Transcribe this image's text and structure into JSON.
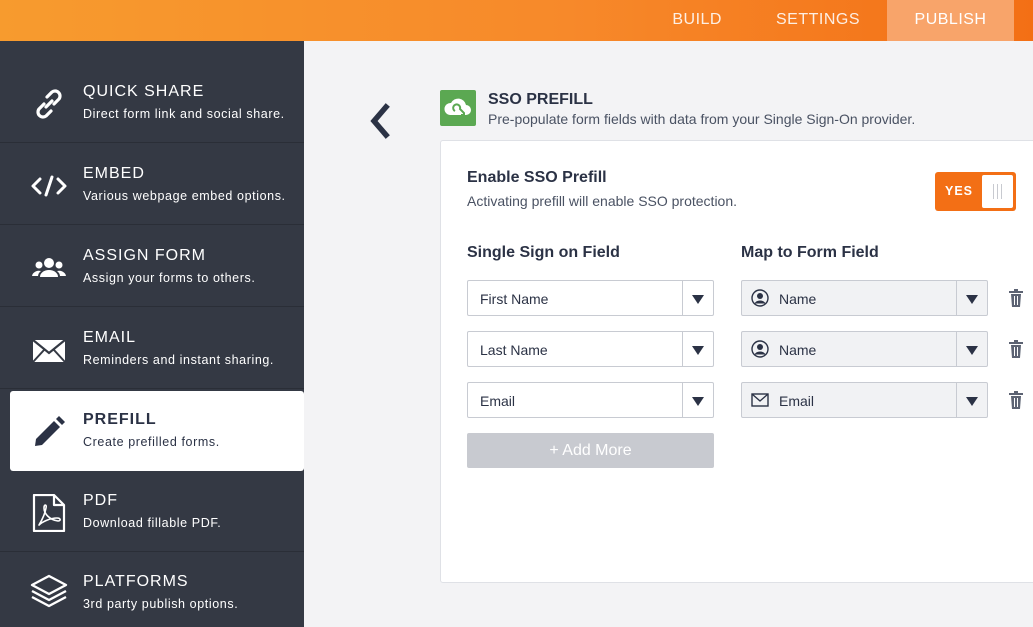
{
  "topnav": {
    "tabs": [
      {
        "label": "BUILD"
      },
      {
        "label": "SETTINGS"
      },
      {
        "label": "PUBLISH",
        "active": true
      }
    ]
  },
  "sidebar": {
    "items": [
      {
        "title": "QUICK SHARE",
        "subtitle": "Direct form link and social share.",
        "icon": "link-icon"
      },
      {
        "title": "EMBED",
        "subtitle": "Various webpage embed options.",
        "icon": "code-icon"
      },
      {
        "title": "ASSIGN FORM",
        "subtitle": "Assign your forms to others.",
        "icon": "users-icon"
      },
      {
        "title": "EMAIL",
        "subtitle": "Reminders and instant sharing.",
        "icon": "envelope-icon"
      },
      {
        "title": "PREFILL",
        "subtitle": "Create prefilled forms.",
        "icon": "pencil-icon",
        "active": true
      },
      {
        "title": "PDF",
        "subtitle": "Download fillable PDF.",
        "icon": "pdf-icon"
      },
      {
        "title": "PLATFORMS",
        "subtitle": "3rd party publish options.",
        "icon": "layers-icon"
      }
    ]
  },
  "header": {
    "title": "SSO PREFILL",
    "subtitle": "Pre-populate form fields with data from your Single Sign-On provider."
  },
  "panel": {
    "enable_title": "Enable SSO Prefill",
    "enable_subtitle": "Activating prefill will enable SSO protection.",
    "toggle_label": "YES",
    "col_sso": "Single Sign on Field",
    "col_map": "Map to Form Field",
    "rows": [
      {
        "sso_field": "First Name",
        "form_field": "Name",
        "form_icon": "user-icon"
      },
      {
        "sso_field": "Last Name",
        "form_field": "Name",
        "form_icon": "user-icon"
      },
      {
        "sso_field": "Email",
        "form_field": "Email",
        "form_icon": "envelope-icon"
      }
    ],
    "add_more": "+ Add More"
  },
  "colors": {
    "accent": "#f36f15",
    "sidebar_bg": "#343944",
    "sso_icon_bg": "#5ba852"
  }
}
